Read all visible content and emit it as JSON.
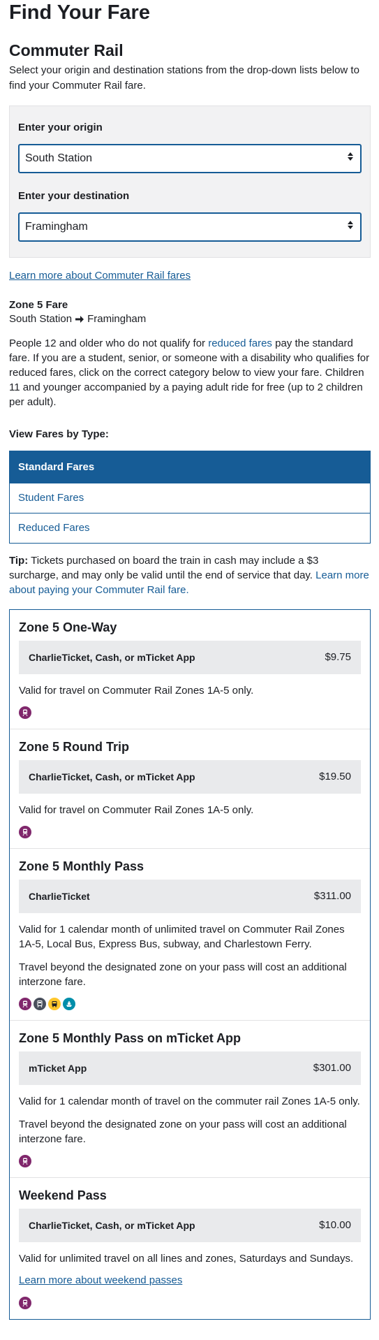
{
  "page": {
    "title": "Find Your Fare",
    "section_title": "Commuter Rail",
    "intro": "Select your origin and destination stations from the drop-down lists below to find your Commuter Rail fare."
  },
  "selector": {
    "origin_label": "Enter your origin",
    "origin_value": "South Station",
    "destination_label": "Enter your destination",
    "destination_value": "Framingham"
  },
  "learn_more_link": "Learn more about Commuter Rail fares",
  "result": {
    "zone_title": "Zone 5 Fare",
    "origin": "South Station",
    "destination": "Framingham",
    "desc_prefix": "People 12 and older who do not qualify for ",
    "desc_link": "reduced fares",
    "desc_suffix": " pay the standard fare. If you are a student, senior, or someone with a disability who qualifies for reduced fares, click on the correct category below to view your fare. Children 11 and younger accompanied by a paying adult ride for free (up to 2 children per adult)."
  },
  "fare_types": {
    "label": "View Fares by Type:",
    "tabs": [
      {
        "label": "Standard Fares"
      },
      {
        "label": "Student Fares"
      },
      {
        "label": "Reduced Fares"
      }
    ]
  },
  "tip": {
    "label": "Tip:",
    "text": " Tickets purchased on board the train in cash may include a $3 surcharge, and may only be valid until the end of service that day. ",
    "link": "Learn more about paying your Commuter Rail fare."
  },
  "fares": [
    {
      "title": "Zone 5 One-Way",
      "media": "CharlieTicket, Cash, or mTicket App",
      "price": "$9.75",
      "text1": "Valid for travel on Commuter Rail Zones 1A-5 only."
    },
    {
      "title": "Zone 5 Round Trip",
      "media": "CharlieTicket, Cash, or mTicket App",
      "price": "$19.50",
      "text1": "Valid for travel on Commuter Rail Zones 1A-5 only."
    },
    {
      "title": "Zone 5 Monthly Pass",
      "media": "CharlieTicket",
      "price": "$311.00",
      "text1": "Valid for 1 calendar month of unlimited travel on Commuter Rail Zones 1A-5, Local Bus, Express Bus, subway, and Charlestown Ferry.",
      "text2": "Travel beyond the designated zone on your pass will cost an additional interzone fare."
    },
    {
      "title": "Zone 5 Monthly Pass on mTicket App",
      "media": "mTicket App",
      "price": "$301.00",
      "text1": "Valid for 1 calendar month of travel on the commuter rail Zones 1A-5 only.",
      "text2": "Travel beyond the designated zone on your pass will cost an additional interzone fare."
    },
    {
      "title": "Weekend Pass",
      "media": "CharlieTicket, Cash, or mTicket App",
      "price": "$10.00",
      "text1": "Valid for unlimited travel on all lines and zones, Saturdays and Sundays.",
      "link": "Learn more about weekend passes"
    }
  ],
  "icons": {
    "commuter_rail": {
      "name": "commuter-rail-icon",
      "color": "#80276c"
    },
    "subway": {
      "name": "subway-icon",
      "color": "#494f5c"
    },
    "bus": {
      "name": "bus-icon",
      "color": "#ffc72c"
    },
    "ferry": {
      "name": "ferry-icon",
      "color": "#008eaa"
    }
  },
  "colors": {
    "link": "#165c96",
    "active_tab": "#165c96",
    "price_row": "#e9eaec",
    "selector_bg": "#f2f2f3"
  }
}
